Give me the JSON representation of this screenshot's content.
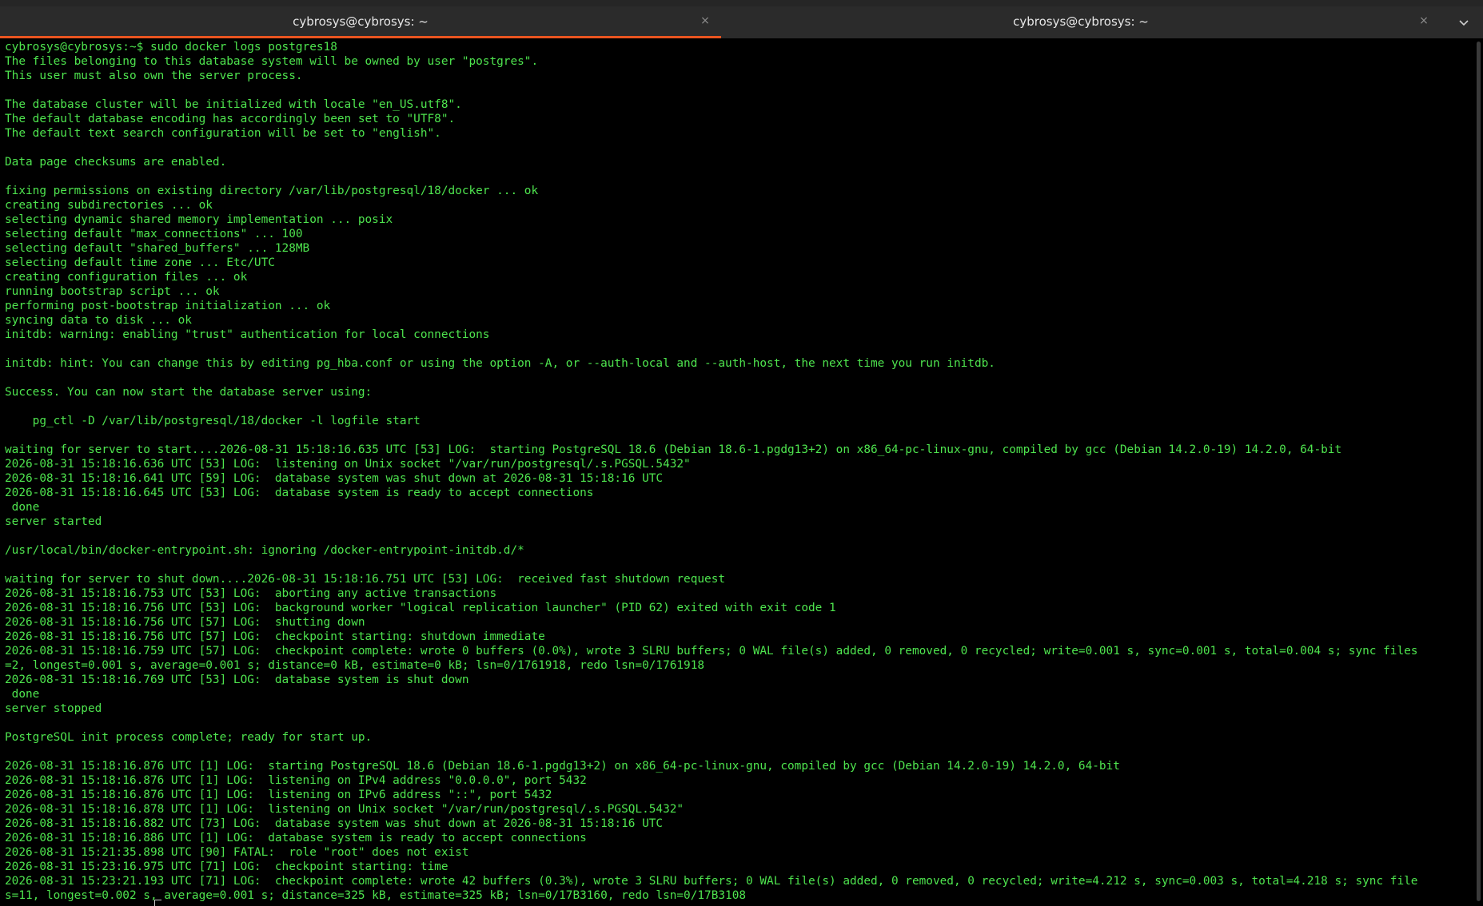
{
  "tabs": [
    {
      "title": "cybrosys@cybrosys: ~",
      "close_glyph": "×",
      "active": true
    },
    {
      "title": "cybrosys@cybrosys: ~",
      "close_glyph": "×",
      "active": false
    }
  ],
  "menu_icon": "chevron-down-icon",
  "colors": {
    "terminal_bg": "#000000",
    "terminal_fg": "#4ee44e",
    "tab_accent": "#e95420",
    "tabbar_bg": "#2b2b2b"
  },
  "terminal": {
    "prompt": "cybrosys@cybrosys:~$",
    "command": " sudo docker logs postgres18",
    "lines": [
      "The files belonging to this database system will be owned by user \"postgres\".",
      "This user must also own the server process.",
      "",
      "The database cluster will be initialized with locale \"en_US.utf8\".",
      "The default database encoding has accordingly been set to \"UTF8\".",
      "The default text search configuration will be set to \"english\".",
      "",
      "Data page checksums are enabled.",
      "",
      "fixing permissions on existing directory /var/lib/postgresql/18/docker ... ok",
      "creating subdirectories ... ok",
      "selecting dynamic shared memory implementation ... posix",
      "selecting default \"max_connections\" ... 100",
      "selecting default \"shared_buffers\" ... 128MB",
      "selecting default time zone ... Etc/UTC",
      "creating configuration files ... ok",
      "running bootstrap script ... ok",
      "performing post-bootstrap initialization ... ok",
      "syncing data to disk ... ok",
      "initdb: warning: enabling \"trust\" authentication for local connections",
      "",
      "initdb: hint: You can change this by editing pg_hba.conf or using the option -A, or --auth-local and --auth-host, the next time you run initdb.",
      "",
      "Success. You can now start the database server using:",
      "",
      "    pg_ctl -D /var/lib/postgresql/18/docker -l logfile start",
      "",
      "waiting for server to start....2026-08-31 15:18:16.635 UTC [53] LOG:  starting PostgreSQL 18.6 (Debian 18.6-1.pgdg13+2) on x86_64-pc-linux-gnu, compiled by gcc (Debian 14.2.0-19) 14.2.0, 64-bit",
      "2026-08-31 15:18:16.636 UTC [53] LOG:  listening on Unix socket \"/var/run/postgresql/.s.PGSQL.5432\"",
      "2026-08-31 15:18:16.641 UTC [59] LOG:  database system was shut down at 2026-08-31 15:18:16 UTC",
      "2026-08-31 15:18:16.645 UTC [53] LOG:  database system is ready to accept connections",
      " done",
      "server started",
      "",
      "/usr/local/bin/docker-entrypoint.sh: ignoring /docker-entrypoint-initdb.d/*",
      "",
      "waiting for server to shut down....2026-08-31 15:18:16.751 UTC [53] LOG:  received fast shutdown request",
      "2026-08-31 15:18:16.753 UTC [53] LOG:  aborting any active transactions",
      "2026-08-31 15:18:16.756 UTC [53] LOG:  background worker \"logical replication launcher\" (PID 62) exited with exit code 1",
      "2026-08-31 15:18:16.756 UTC [57] LOG:  shutting down",
      "2026-08-31 15:18:16.756 UTC [57] LOG:  checkpoint starting: shutdown immediate",
      "2026-08-31 15:18:16.759 UTC [57] LOG:  checkpoint complete: wrote 0 buffers (0.0%), wrote 3 SLRU buffers; 0 WAL file(s) added, 0 removed, 0 recycled; write=0.001 s, sync=0.001 s, total=0.004 s; sync files",
      "=2, longest=0.001 s, average=0.001 s; distance=0 kB, estimate=0 kB; lsn=0/1761918, redo lsn=0/1761918",
      "2026-08-31 15:18:16.769 UTC [53] LOG:  database system is shut down",
      " done",
      "server stopped",
      "",
      "PostgreSQL init process complete; ready for start up.",
      "",
      "2026-08-31 15:18:16.876 UTC [1] LOG:  starting PostgreSQL 18.6 (Debian 18.6-1.pgdg13+2) on x86_64-pc-linux-gnu, compiled by gcc (Debian 14.2.0-19) 14.2.0, 64-bit",
      "2026-08-31 15:18:16.876 UTC [1] LOG:  listening on IPv4 address \"0.0.0.0\", port 5432",
      "2026-08-31 15:18:16.876 UTC [1] LOG:  listening on IPv6 address \"::\", port 5432",
      "2026-08-31 15:18:16.878 UTC [1] LOG:  listening on Unix socket \"/var/run/postgresql/.s.PGSQL.5432\"",
      "2026-08-31 15:18:16.882 UTC [73] LOG:  database system was shut down at 2026-08-31 15:18:16 UTC",
      "2026-08-31 15:18:16.886 UTC [1] LOG:  database system is ready to accept connections",
      "2026-08-31 15:21:35.898 UTC [90] FATAL:  role \"root\" does not exist",
      "2026-08-31 15:23:16.975 UTC [71] LOG:  checkpoint starting: time",
      "2026-08-31 15:23:21.193 UTC [71] LOG:  checkpoint complete: wrote 42 buffers (0.3%), wrote 3 SLRU buffers; 0 WAL file(s) added, 0 removed, 0 recycled; write=4.212 s, sync=0.003 s, total=4.218 s; sync file",
      "s=11, longest=0.002 s, average=0.001 s; distance=325 kB, estimate=325 kB; lsn=0/17B3160, redo lsn=0/17B3108"
    ]
  }
}
